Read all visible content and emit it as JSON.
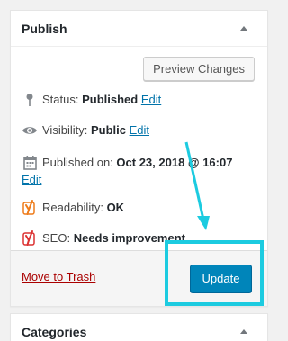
{
  "publish": {
    "title": "Publish",
    "preview_label": "Preview Changes",
    "status": {
      "label": "Status:",
      "value": "Published",
      "edit": "Edit"
    },
    "visibility": {
      "label": "Visibility:",
      "value": "Public",
      "edit": "Edit"
    },
    "published_on": {
      "label": "Published on:",
      "value": "Oct 23, 2018 @ 16:07",
      "edit": "Edit"
    },
    "readability": {
      "label": "Readability:",
      "value": "OK"
    },
    "seo": {
      "label": "SEO:",
      "value": "Needs improvement"
    },
    "trash_label": "Move to Trash",
    "update_label": "Update"
  },
  "categories": {
    "title": "Categories"
  },
  "icons": {
    "status": "pin-icon",
    "visibility": "eye-icon",
    "published_on": "calendar-icon",
    "readability": "yoast-icon",
    "seo": "yoast-icon"
  },
  "colors": {
    "accent": "#0085ba",
    "link": "#0073aa",
    "trash": "#a00000",
    "annotation": "#1ccbe0",
    "yoast_ok": "#ee7c1b",
    "yoast_bad": "#dc3232"
  }
}
